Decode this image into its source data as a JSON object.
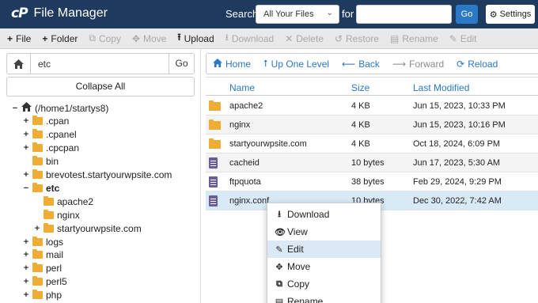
{
  "header": {
    "logo": "cP",
    "title": "File Manager",
    "search_label": "Search",
    "search_scope": "All Your Files",
    "for_label": "for",
    "search_value": "",
    "go_label": "Go",
    "settings_label": "Settings"
  },
  "toolbar": {
    "file": "File",
    "folder": "Folder",
    "copy": "Copy",
    "move": "Move",
    "upload": "Upload",
    "download": "Download",
    "delete": "Delete",
    "restore": "Restore",
    "rename": "Rename",
    "edit": "Edit"
  },
  "left": {
    "path_value": "etc",
    "go_label": "Go",
    "collapse_label": "Collapse All",
    "tree": [
      {
        "label": "(/home1/startys8)",
        "toggle": "−",
        "level": 0,
        "home": true
      },
      {
        "label": ".cpan",
        "toggle": "+",
        "level": 1
      },
      {
        "label": ".cpanel",
        "toggle": "+",
        "level": 1
      },
      {
        "label": ".cpcpan",
        "toggle": "+",
        "level": 1
      },
      {
        "label": "bin",
        "toggle": "",
        "level": 1
      },
      {
        "label": "brevotest.startyourwpsite.com",
        "toggle": "+",
        "level": 1
      },
      {
        "label": "etc",
        "toggle": "−",
        "level": 1,
        "bold": true
      },
      {
        "label": "apache2",
        "toggle": "",
        "level": 2
      },
      {
        "label": "nginx",
        "toggle": "",
        "level": 2
      },
      {
        "label": "startyourwpsite.com",
        "toggle": "+",
        "level": 2
      },
      {
        "label": "logs",
        "toggle": "+",
        "level": 1
      },
      {
        "label": "mail",
        "toggle": "+",
        "level": 1
      },
      {
        "label": "perl",
        "toggle": "+",
        "level": 1
      },
      {
        "label": "perl5",
        "toggle": "+",
        "level": 1
      },
      {
        "label": "php",
        "toggle": "+",
        "level": 1
      }
    ]
  },
  "nav": {
    "home": "Home",
    "up_one_level": "Up One Level",
    "back": "Back",
    "forward": "Forward",
    "reload": "Reload"
  },
  "table": {
    "columns": {
      "name": "Name",
      "size": "Size",
      "modified": "Last Modified"
    },
    "rows": [
      {
        "name": "apache2",
        "size": "4 KB",
        "modified": "Jun 15, 2023, 10:33 PM",
        "type": "folder"
      },
      {
        "name": "nginx",
        "size": "4 KB",
        "modified": "Jun 15, 2023, 10:16 PM",
        "type": "folder"
      },
      {
        "name": "startyourwpsite.com",
        "size": "4 KB",
        "modified": "Oct 18, 2024, 6:09 PM",
        "type": "folder"
      },
      {
        "name": "cacheid",
        "size": "10 bytes",
        "modified": "Jun 17, 2023, 5:30 AM",
        "type": "file"
      },
      {
        "name": "ftpquota",
        "size": "38 bytes",
        "modified": "Feb 29, 2024, 9:29 PM",
        "type": "file"
      },
      {
        "name": "nginx.conf",
        "size": "10 bytes",
        "modified": "Dec 30, 2022, 7:42 AM",
        "type": "file"
      }
    ]
  },
  "context_menu": {
    "download": "Download",
    "view": "View",
    "edit": "Edit",
    "move": "Move",
    "copy": "Copy",
    "rename": "Rename"
  },
  "colors": {
    "header_bg": "#1f3a5f",
    "accent": "#2a78c6",
    "folder": "#f0ad35",
    "file_icon": "#6a5d9a",
    "selected_row": "#d9eaf7"
  }
}
